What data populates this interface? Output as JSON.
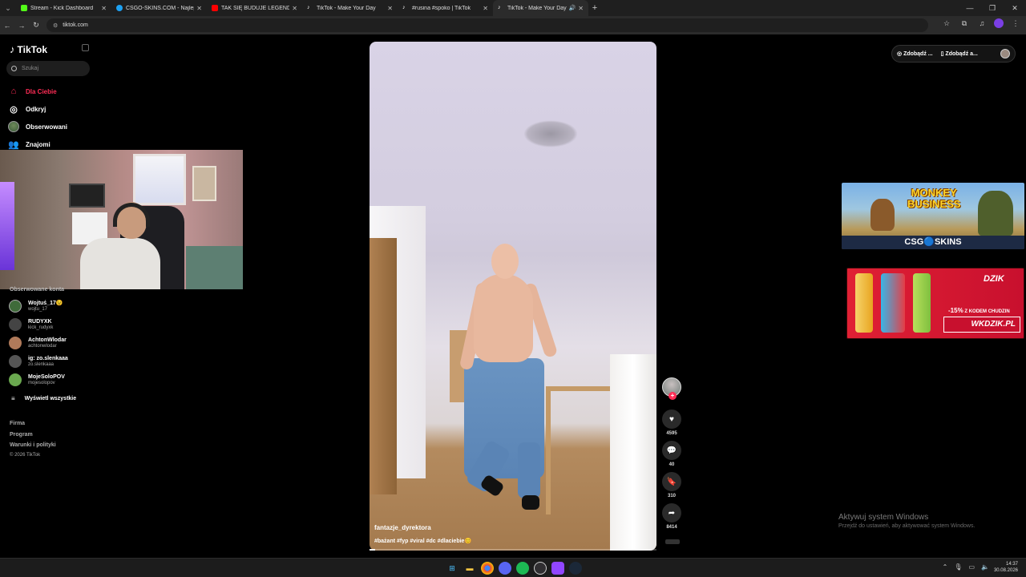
{
  "browser": {
    "tabs": [
      {
        "title": "Stream - Kick Dashboard",
        "color": "#53fc18",
        "active": false
      },
      {
        "title": "CSGO-SKINS.COM - Najlepsze",
        "color": "#1da1f2",
        "active": false
      },
      {
        "title": "TAK SIĘ BUDUJE LEGENDĘ - Yo",
        "color": "#ff0000",
        "active": false
      },
      {
        "title": "TikTok - Make Your Day",
        "color": "#ffffff",
        "active": false
      },
      {
        "title": "#rusina #spoko | TikTok",
        "color": "#ffffff",
        "active": false
      },
      {
        "title": "TikTok - Make Your Day",
        "color": "#ffffff",
        "active": true
      }
    ],
    "url": "tiktok.com"
  },
  "sidebar": {
    "logo": "TikTok",
    "search_placeholder": "Szukaj",
    "nav": [
      {
        "label": "Dla Ciebie",
        "icon": "home-icon",
        "active": true
      },
      {
        "label": "Odkryj",
        "icon": "compass-icon",
        "active": false
      },
      {
        "label": "Obserwowani",
        "icon": "avatar-icon",
        "active": false
      },
      {
        "label": "Znajomi",
        "icon": "friends-icon",
        "active": false
      }
    ],
    "followed_title": "Obserwowane konta",
    "accounts": [
      {
        "name": "Wojtuś_17😉",
        "handle": "wojtu_17",
        "color": "#3f6b3a"
      },
      {
        "name": "RUDYXK",
        "handle": "kick_rudyxk",
        "color": "#444444"
      },
      {
        "name": "AchtonWlodar",
        "handle": "achtonwlodar",
        "color": "#b07a5a"
      },
      {
        "name": "ig: zo.slenkaaa",
        "handle": "zo.slenkaaa",
        "color": "#555555"
      },
      {
        "name": "MojeSoloPOV",
        "handle": "mojesolopov",
        "color": "#6aa84f"
      }
    ],
    "show_all": "Wyświetl wszystkie",
    "footer": [
      "Firma",
      "Program",
      "Warunki i polityki"
    ],
    "copyright": "© 2026 TikTok"
  },
  "video": {
    "author": "fantazje_dyrektora",
    "description": "#bażant #fyp #viral #dc #dlaciebie😊",
    "progress": 0.02
  },
  "actions": {
    "likes": "4595",
    "comments": "40",
    "saves": "310",
    "shares": "8414"
  },
  "topright": {
    "btn1": "Zdobądź ...",
    "btn2": "Zdobądź a..."
  },
  "ads": {
    "ad1_title_line1": "MONKEY",
    "ad1_title_line2": "BUSINESS",
    "ad1_brand": "CSG🔵SKINS",
    "ad2_brand": "DZIK",
    "ad2_promo_pct": "-15%",
    "ad2_promo_text": "Z KODEM CHUDZIN",
    "ad2_url": "WKDZIK.PL"
  },
  "watermark": {
    "line1": "Aktywuj system Windows",
    "line2": "Przejdź do ustawień, aby aktywować system Windows."
  },
  "taskbar": {
    "time": "14:37",
    "date": "30.08.2026"
  }
}
